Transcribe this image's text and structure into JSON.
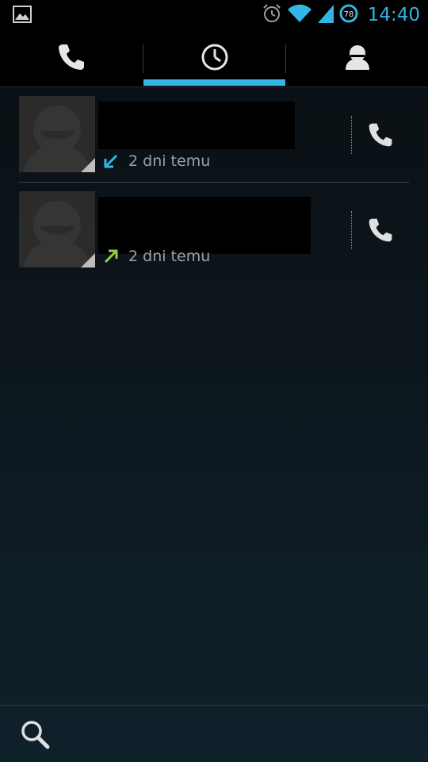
{
  "status_bar": {
    "time": "14:40",
    "battery_level": "78",
    "icons": [
      "gallery-notification-icon",
      "alarm-icon",
      "wifi-icon",
      "cell-signal-icon",
      "battery-icon"
    ]
  },
  "tabs": [
    {
      "icon": "phone-icon",
      "selected": false
    },
    {
      "icon": "clock-icon",
      "selected": true
    },
    {
      "icon": "person-icon",
      "selected": false
    }
  ],
  "call_log": [
    {
      "name": "",
      "call_type": "incoming",
      "time_ago": "2 dni temu",
      "arrow_color": "#33b5e5"
    },
    {
      "name": "",
      "call_type": "outgoing",
      "time_ago": "2 dni temu",
      "arrow_color": "#8fcf3c"
    }
  ],
  "bottom_bar": {
    "icon": "search-icon"
  },
  "colors": {
    "accent": "#33b5e5",
    "outgoing": "#8fcf3c"
  }
}
